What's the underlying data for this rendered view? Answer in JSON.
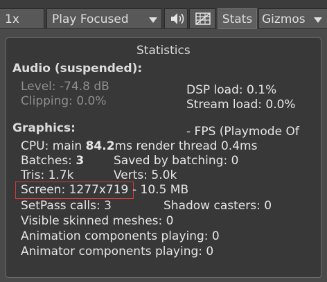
{
  "toolbar": {
    "scale_label": "1x",
    "play_mode_label": "Play Focused",
    "audio_icon": "speaker-icon",
    "grid_icon": "grid-toggle-icon",
    "stats_label": "Stats",
    "gizmos_label": "Gizmos"
  },
  "stats": {
    "title": "Statistics",
    "audio": {
      "header": "Audio (suspended):",
      "level": "Level: -74.8 dB",
      "clipping": "Clipping: 0.0%",
      "dsp_load": "DSP load: 0.1%",
      "stream_load": "Stream load: 0.0%"
    },
    "graphics": {
      "header": "Graphics:",
      "fps": "- FPS (Playmode Of",
      "cpu_prefix": "CPU: main ",
      "cpu_main": "84.2",
      "cpu_suffix": "ms  render thread 0.4ms",
      "batches_prefix": "Batches: ",
      "batches": "3",
      "saved_by_batching": "Saved by batching: 0",
      "tris": "Tris: 1.7k",
      "verts": "Verts: 5.0k",
      "screen": "Screen: 1277x719",
      "screen_mem": "- 10.5 MB",
      "setpass": "SetPass calls: 3",
      "shadow_casters": "Shadow casters: 0",
      "skinned_meshes": "Visible skinned meshes: 0",
      "animation_components": "Animation components playing: 0",
      "animator_components": "Animator components playing: 0"
    }
  },
  "colors": {
    "panel_bg": "#383838",
    "highlight": "#d23c3c"
  }
}
